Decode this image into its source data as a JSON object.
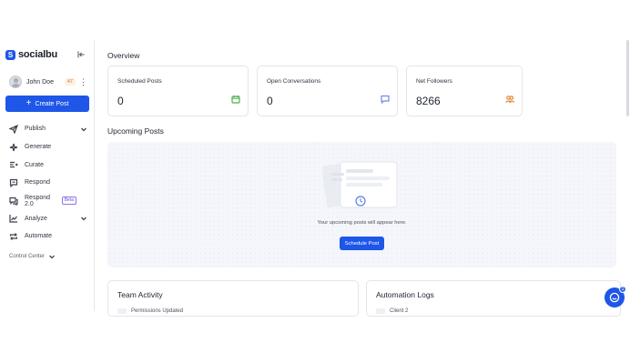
{
  "brand": {
    "name": "socialbu",
    "logo_letter": "S",
    "accent": "#1e56e8"
  },
  "user": {
    "name": "John Doe",
    "badge": "47"
  },
  "create_button": {
    "label": "Create Post"
  },
  "nav": {
    "items": [
      {
        "label": "Publish",
        "icon": "send-icon",
        "has_chevron": true
      },
      {
        "label": "Generate",
        "icon": "sparkles-icon"
      },
      {
        "label": "Curate",
        "icon": "curate-icon"
      },
      {
        "label": "Respond",
        "icon": "message-icon"
      },
      {
        "label": "Respond 2.0",
        "icon": "messages-icon",
        "badge": "Beta"
      },
      {
        "label": "Analyze",
        "icon": "chart-icon",
        "has_chevron": true
      },
      {
        "label": "Automate",
        "icon": "repeat-icon"
      }
    ],
    "control_center": "Control Center"
  },
  "overview": {
    "title": "Overview",
    "cards": [
      {
        "label": "Scheduled Posts",
        "value": "0",
        "icon": "calendar-icon",
        "icon_color": "#4caf50"
      },
      {
        "label": "Open Conversations",
        "value": "0",
        "icon": "chat-icon",
        "icon_color": "#7b83e8"
      },
      {
        "label": "Net Followers",
        "value": "8266",
        "icon": "users-icon",
        "icon_color": "#e6842e"
      }
    ]
  },
  "upcoming": {
    "title": "Upcoming Posts",
    "empty_text": "Your upcoming posts will appear here.",
    "button": "Schedule Post"
  },
  "team_activity": {
    "title": "Team Activity",
    "first_row": "Permissions Updated"
  },
  "automation_logs": {
    "title": "Automation Logs",
    "first_row": "Client 2"
  },
  "chat_widget": {
    "badge": "1"
  }
}
